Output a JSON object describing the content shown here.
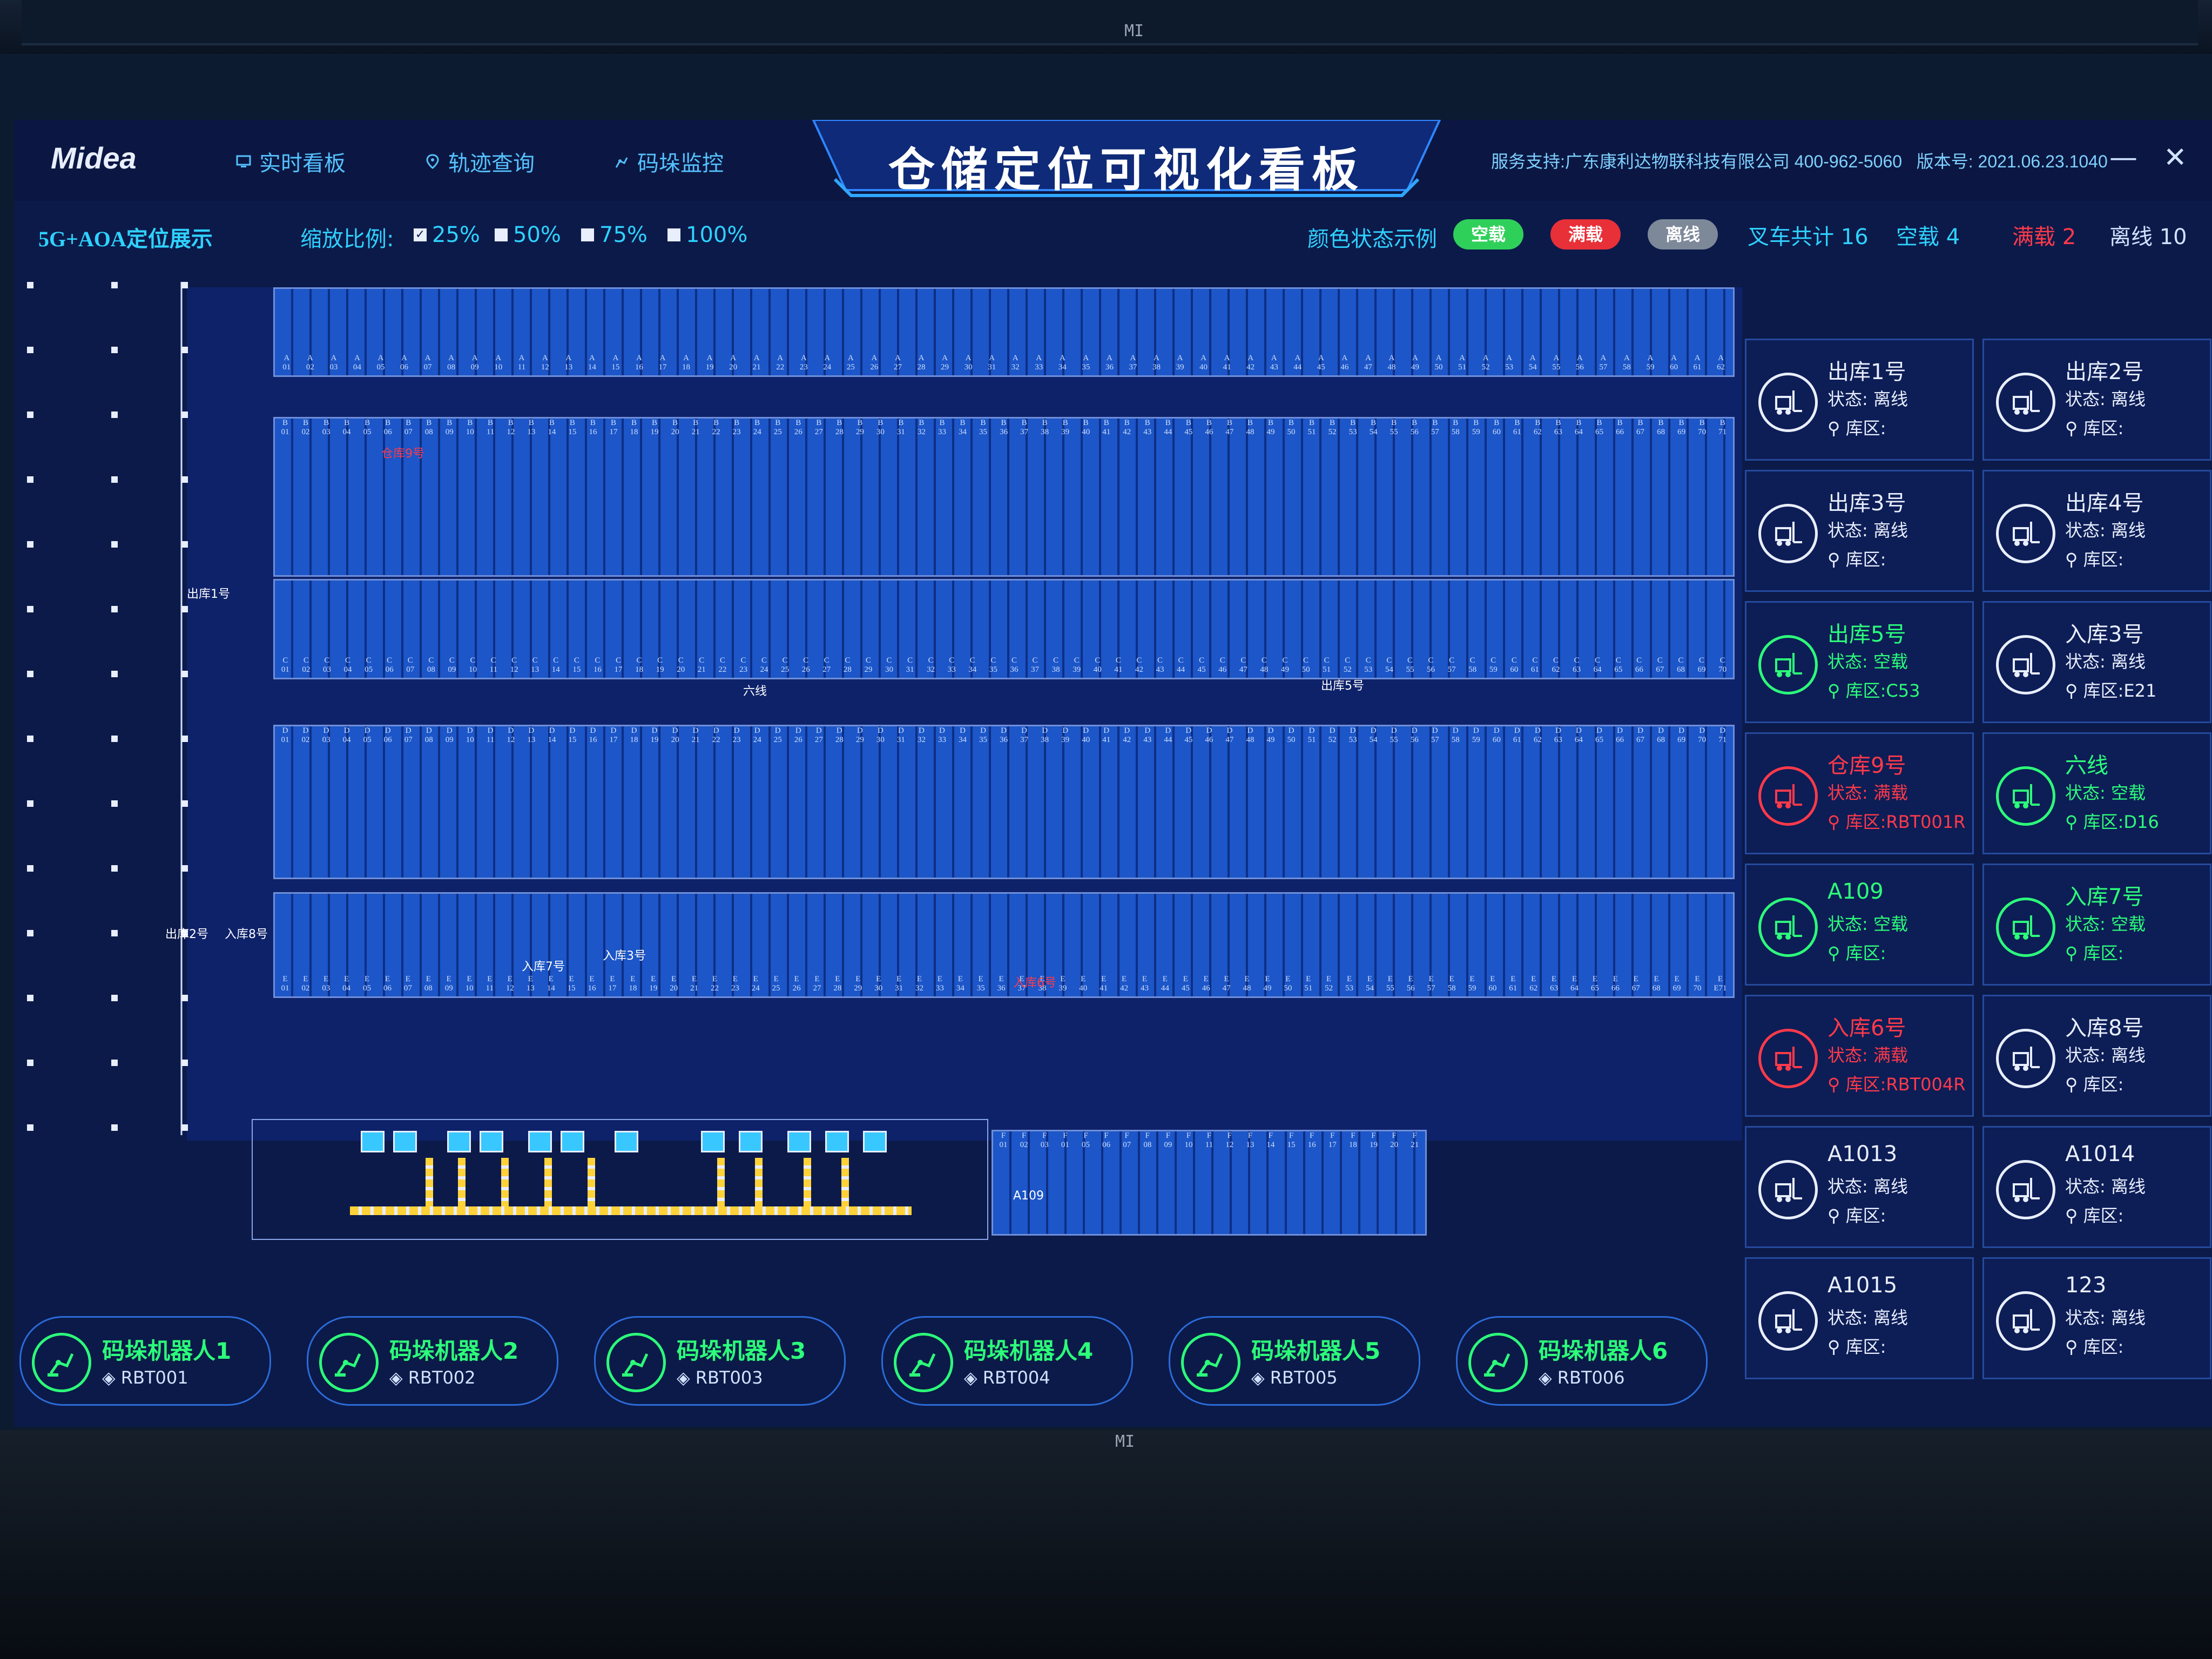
{
  "app": {
    "logo": "Midea",
    "title": "仓储定位可视化看板",
    "support": "服务支持:广东康利达物联科技有限公司 400-962-5060",
    "version": "版本号: 2021.06.23.1040",
    "minimize": "—",
    "close": "✕"
  },
  "nav": [
    {
      "label": "实时看板",
      "icon": "monitor-icon"
    },
    {
      "label": "轨迹查询",
      "icon": "location-pin-icon"
    },
    {
      "label": "码垛监控",
      "icon": "robot-arm-icon"
    }
  ],
  "toolbar": {
    "mode": "5G+AOA定位展示",
    "zoom_label": "缩放比例:",
    "zoom_options": [
      {
        "label": "25%",
        "checked": true
      },
      {
        "label": "50%",
        "checked": false
      },
      {
        "label": "75%",
        "checked": false
      },
      {
        "label": "100%",
        "checked": false
      }
    ],
    "legend_label": "颜色状态示例",
    "legend": [
      {
        "label": "空载",
        "color": "#2fd05a"
      },
      {
        "label": "满载",
        "color": "#e83038"
      },
      {
        "label": "离线",
        "color": "#7d8899"
      }
    ],
    "stats": {
      "total": "叉车共计 16",
      "empty": "空载  4",
      "full": "满载  2",
      "offline": "离线  10"
    }
  },
  "map": {
    "rows": [
      {
        "prefix": "A",
        "labels": [
          "01",
          "02",
          "03",
          "04",
          "05",
          "06",
          "07",
          "08",
          "09",
          "10",
          "11",
          "12",
          "13",
          "14",
          "15",
          "16",
          "17",
          "18",
          "19",
          "20",
          "21",
          "22",
          "23",
          "24",
          "25",
          "26",
          "27",
          "28",
          "29",
          "30",
          "31",
          "32",
          "33",
          "34",
          "35",
          "36",
          "37",
          "38",
          "39",
          "40",
          "41",
          "42",
          "43",
          "44",
          "45",
          "46",
          "47",
          "48",
          "49",
          "50",
          "51",
          "52",
          "53",
          "54",
          "55",
          "56",
          "57",
          "58",
          "59",
          "60",
          "61",
          "62"
        ]
      },
      {
        "prefix": "B",
        "labels": [
          "01",
          "02",
          "03",
          "04",
          "05",
          "06",
          "07",
          "08",
          "09",
          "10",
          "11",
          "12",
          "13",
          "14",
          "15",
          "16",
          "17",
          "18",
          "19",
          "20",
          "21",
          "22",
          "23",
          "24",
          "25",
          "26",
          "27",
          "28",
          "29",
          "30",
          "31",
          "32",
          "33",
          "34",
          "35",
          "36",
          "37",
          "38",
          "39",
          "40",
          "41",
          "42",
          "43",
          "44",
          "45",
          "46",
          "47",
          "48",
          "49",
          "50",
          "51",
          "52",
          "53",
          "54",
          "55",
          "56",
          "57",
          "58",
          "59",
          "60",
          "61",
          "62",
          "63",
          "64",
          "65",
          "66",
          "67",
          "68",
          "69",
          "70",
          "71"
        ]
      },
      {
        "prefix": "C",
        "labels": [
          "01",
          "02",
          "03",
          "04",
          "05",
          "06",
          "07",
          "08",
          "09",
          "10",
          "11",
          "12",
          "13",
          "14",
          "15",
          "16",
          "17",
          "18",
          "19",
          "20",
          "21",
          "22",
          "23",
          "24",
          "25",
          "26",
          "27",
          "28",
          "29",
          "30",
          "31",
          "32",
          "33",
          "34",
          "35",
          "36",
          "37",
          "38",
          "39",
          "40",
          "41",
          "42",
          "43",
          "44",
          "45",
          "46",
          "47",
          "48",
          "49",
          "50",
          "51",
          "52",
          "53",
          "54",
          "55",
          "56",
          "57",
          "58",
          "59",
          "60",
          "61",
          "62",
          "63",
          "64",
          "65",
          "66",
          "67",
          "68",
          "69",
          "70"
        ]
      },
      {
        "prefix": "D",
        "labels": [
          "01",
          "02",
          "03",
          "04",
          "05",
          "06",
          "07",
          "08",
          "09",
          "10",
          "11",
          "12",
          "13",
          "14",
          "15",
          "16",
          "17",
          "18",
          "19",
          "20",
          "21",
          "22",
          "23",
          "24",
          "25",
          "26",
          "27",
          "28",
          "29",
          "30",
          "31",
          "32",
          "33",
          "34",
          "35",
          "36",
          "37",
          "38",
          "39",
          "40",
          "41",
          "42",
          "43",
          "44",
          "45",
          "46",
          "47",
          "48",
          "49",
          "50",
          "51",
          "52",
          "53",
          "54",
          "55",
          "56",
          "57",
          "58",
          "59",
          "60",
          "61",
          "62",
          "63",
          "64",
          "65",
          "66",
          "67",
          "68",
          "69",
          "70",
          "71"
        ]
      },
      {
        "prefix": "E",
        "labels": [
          "01",
          "02",
          "03",
          "04",
          "05",
          "06",
          "07",
          "08",
          "09",
          "10",
          "11",
          "12",
          "13",
          "14",
          "15",
          "16",
          "17",
          "18",
          "19",
          "20",
          "21",
          "22",
          "23",
          "24",
          "25",
          "26",
          "27",
          "28",
          "29",
          "30",
          "31",
          "32",
          "33",
          "34",
          "35",
          "36",
          "37",
          "38",
          "39",
          "40",
          "41",
          "42",
          "43",
          "44",
          "45",
          "46",
          "47",
          "48",
          "49",
          "50",
          "51",
          "52",
          "53",
          "54",
          "55",
          "56",
          "57",
          "58",
          "59",
          "60",
          "61",
          "62",
          "63",
          "64",
          "65",
          "66",
          "67",
          "68",
          "69",
          "70",
          "E71"
        ]
      },
      {
        "prefix": "F",
        "labels": [
          "01",
          "02",
          "03",
          "01",
          "05",
          "06",
          "07",
          "08",
          "09",
          "10",
          "11",
          "12",
          "13",
          "14",
          "15",
          "16",
          "17",
          "18",
          "19",
          "20",
          "21"
        ]
      }
    ],
    "markers": {
      "warehouse9": "仓库9号",
      "out1": "出库1号",
      "six_line": "六线",
      "out5": "出库5号",
      "out2": "出库2号",
      "in8": "入库8号",
      "in7": "入库7号",
      "in3": "入库3号",
      "in6": "入库6号",
      "a109": "A109"
    }
  },
  "forklifts": [
    {
      "name": "出库1号",
      "status": "状态: 离线",
      "zone": "库区:",
      "state": "offline"
    },
    {
      "name": "出库2号",
      "status": "状态: 离线",
      "zone": "库区:",
      "state": "offline"
    },
    {
      "name": "出库3号",
      "status": "状态: 离线",
      "zone": "库区:",
      "state": "offline"
    },
    {
      "name": "出库4号",
      "status": "状态: 离线",
      "zone": "库区:",
      "state": "offline"
    },
    {
      "name": "出库5号",
      "status": "状态: 空载",
      "zone": "库区:C53",
      "state": "empty"
    },
    {
      "name": "入库3号",
      "status": "状态: 离线",
      "zone": "库区:E21",
      "state": "offline"
    },
    {
      "name": "仓库9号",
      "status": "状态: 满载",
      "zone": "库区:RBT001R",
      "state": "full"
    },
    {
      "name": "六线",
      "status": "状态: 空载",
      "zone": "库区:D16",
      "state": "empty"
    },
    {
      "name": "A109",
      "status": "状态: 空载",
      "zone": "库区:",
      "state": "empty"
    },
    {
      "name": "入库7号",
      "status": "状态: 空载",
      "zone": "库区:",
      "state": "empty"
    },
    {
      "name": "入库6号",
      "status": "状态: 满载",
      "zone": "库区:RBT004R",
      "state": "full"
    },
    {
      "name": "入库8号",
      "status": "状态: 离线",
      "zone": "库区:",
      "state": "offline"
    },
    {
      "name": "A1013",
      "status": "状态: 离线",
      "zone": "库区:",
      "state": "offline"
    },
    {
      "name": "A1014",
      "status": "状态: 离线",
      "zone": "库区:",
      "state": "offline"
    },
    {
      "name": "A1015",
      "status": "状态: 离线",
      "zone": "库区:",
      "state": "offline"
    },
    {
      "name": "123",
      "status": "状态: 离线",
      "zone": "库区:",
      "state": "offline"
    }
  ],
  "robots": [
    {
      "name": "码垛机器人1",
      "id": "RBT001"
    },
    {
      "name": "码垛机器人2",
      "id": "RBT002"
    },
    {
      "name": "码垛机器人3",
      "id": "RBT003"
    },
    {
      "name": "码垛机器人4",
      "id": "RBT004"
    },
    {
      "name": "码垛机器人5",
      "id": "RBT005"
    },
    {
      "name": "码垛机器人6",
      "id": "RBT006"
    }
  ],
  "bezel_brand": "MI"
}
